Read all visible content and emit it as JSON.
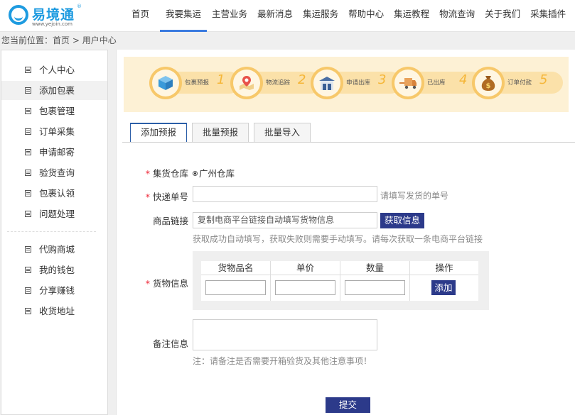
{
  "logo": {
    "name": "易境通",
    "reg": "®",
    "url": "www.yejoin.com"
  },
  "nav": {
    "items": [
      {
        "label": "首页"
      },
      {
        "label": "我要集运"
      },
      {
        "label": "主营业务"
      },
      {
        "label": "最新消息"
      },
      {
        "label": "集运服务"
      },
      {
        "label": "帮助中心"
      },
      {
        "label": "集运教程"
      },
      {
        "label": "物流查询"
      },
      {
        "label": "关于我们"
      },
      {
        "label": "采集插件"
      }
    ]
  },
  "breadcrumb": {
    "prefix": "您当前位置：",
    "home": "首页",
    "sep": " > ",
    "current": "用户中心"
  },
  "sidebar": {
    "items": [
      {
        "label": "个人中心"
      },
      {
        "label": "添加包裹"
      },
      {
        "label": "包裹管理"
      },
      {
        "label": "订单采集"
      },
      {
        "label": "申请邮寄"
      },
      {
        "label": "验货查询"
      },
      {
        "label": "包裹认领"
      },
      {
        "label": "问题处理"
      },
      {
        "label": "代购商城"
      },
      {
        "label": "我的钱包"
      },
      {
        "label": "分享赚钱"
      },
      {
        "label": "收货地址"
      }
    ]
  },
  "steps": [
    {
      "label": "包裹预报",
      "num": "1",
      "icon": "box-icon"
    },
    {
      "label": "物流追踪",
      "num": "2",
      "icon": "map-pin-icon"
    },
    {
      "label": "申请出库",
      "num": "3",
      "icon": "warehouse-icon"
    },
    {
      "label": "已出库",
      "num": "4",
      "icon": "truck-icon"
    },
    {
      "label": "订单付款",
      "num": "5",
      "icon": "money-bag-icon"
    }
  ],
  "tabs": [
    {
      "label": "添加预报"
    },
    {
      "label": "批量预报"
    },
    {
      "label": "批量导入"
    }
  ],
  "form": {
    "required_mark": "*",
    "warehouse_label": "集货仓库",
    "warehouse_value": "广州仓库",
    "tracking_label": "快递单号",
    "tracking_hint": "请填写发货的单号",
    "link_label": "商品链接",
    "link_placeholder": "复制电商平台链接自动填写货物信息",
    "fetch_button": "获取信息",
    "link_hint": "获取成功自动填写，获取失败则需要手动填写。请每次获取一条电商平台链接",
    "goods_label": "货物信息",
    "goods_columns": [
      "货物品名",
      "单价",
      "数量",
      "操作"
    ],
    "add_button": "添加",
    "remark_label": "备注信息",
    "remark_hint": "注：请备注是否需要开箱验货及其他注意事项！",
    "submit_button": "提交"
  }
}
